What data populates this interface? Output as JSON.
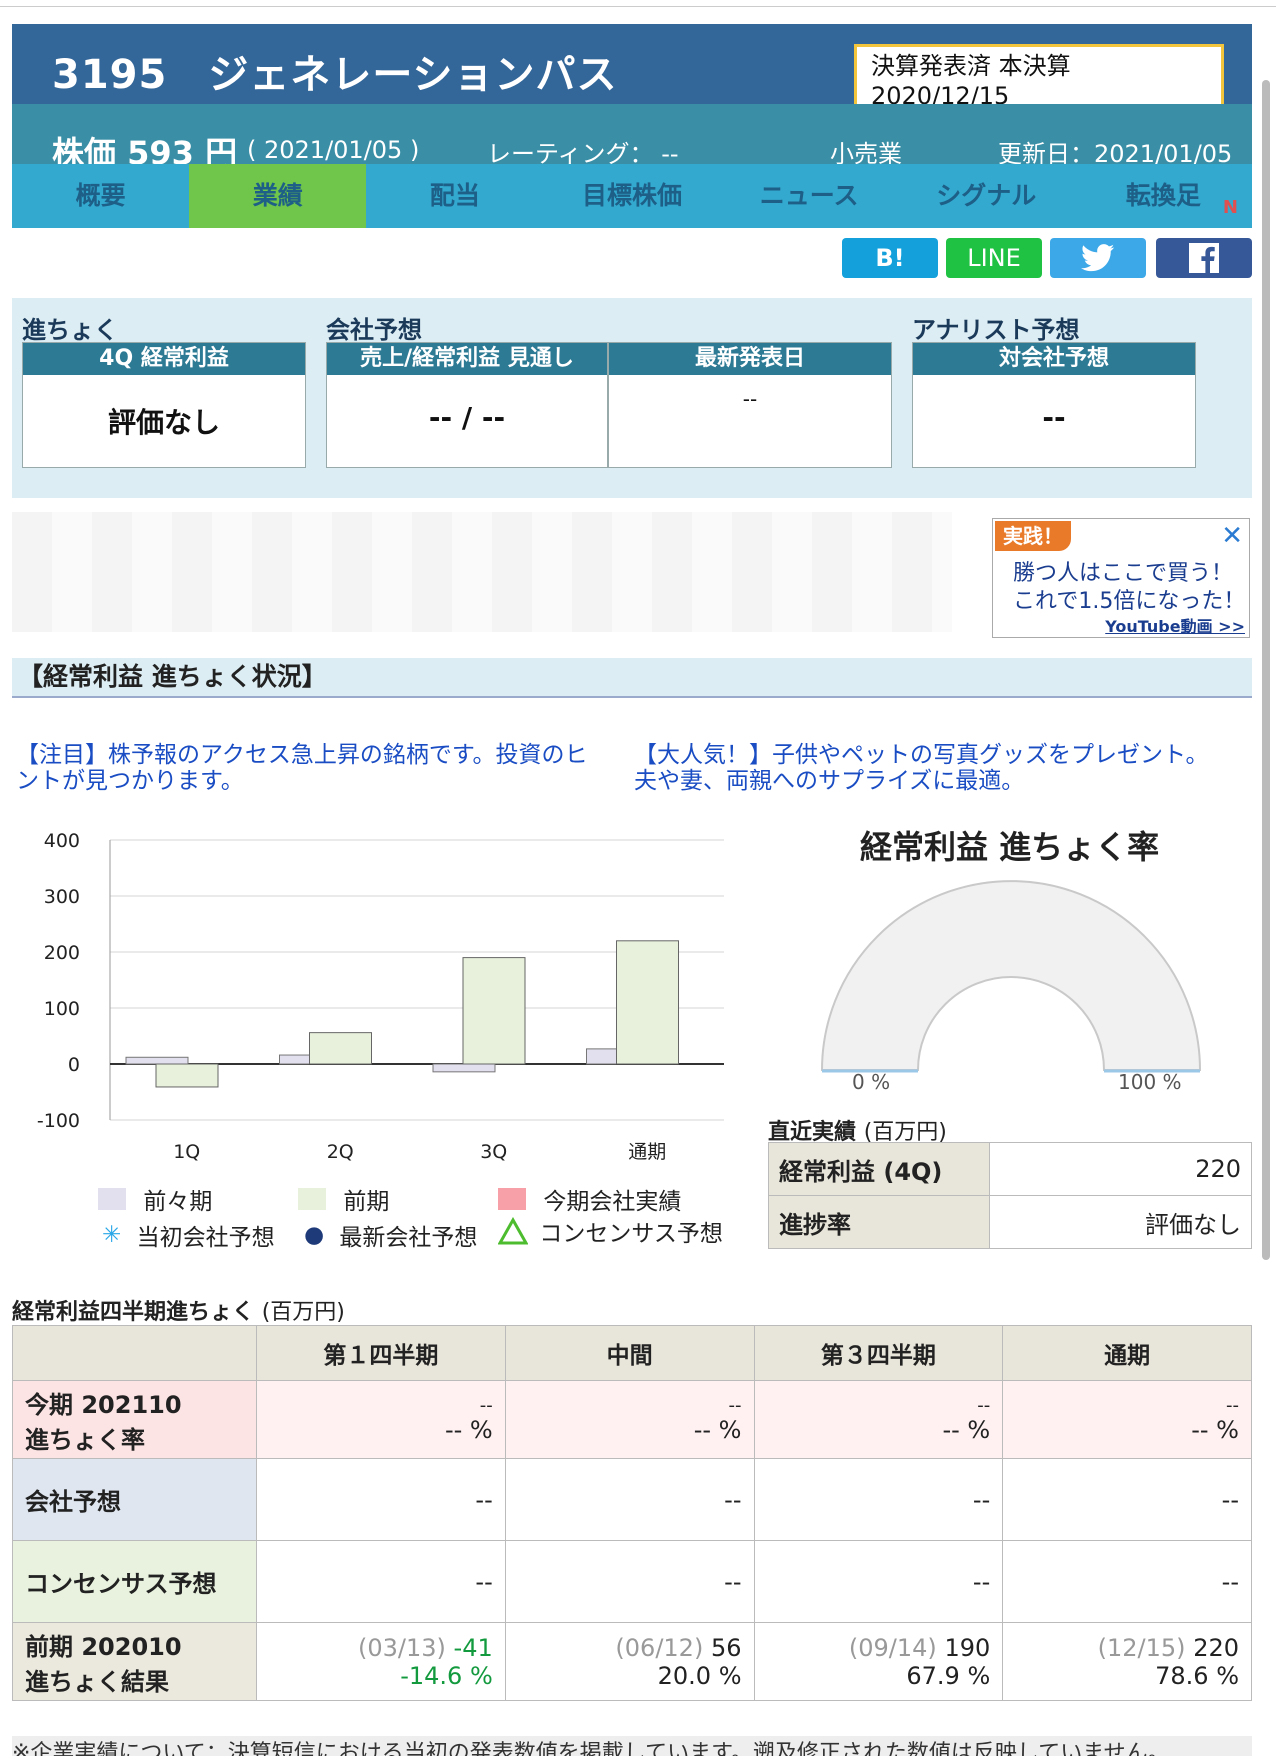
{
  "header": {
    "title": "3195　ジェネレーションパス",
    "kessan_line1": "決算発表済 本決算",
    "kessan_line2": "2020/12/15"
  },
  "pricebar": {
    "price": "株価 593 円",
    "date": "( 2021/01/05 )",
    "rating": "レーティング： --",
    "sector": "小売業",
    "updated": "更新日：2021/01/05"
  },
  "tabs": [
    "概要",
    "業績",
    "配当",
    "目標株価",
    "ニュース",
    "シグナル",
    "転換足"
  ],
  "tab_active_index": 1,
  "tab_sub": "N",
  "share": {
    "hatena": "B!",
    "line": "LINE"
  },
  "panel": {
    "progress_label": "進ちょく",
    "company_label": "会社予想",
    "analyst_label": "アナリスト予想",
    "box1_head": "4Q 経常利益",
    "box1_val": "評価なし",
    "box2_head": "売上/経常利益 見通し",
    "box2_val": "-- / --",
    "box3_head": "最新発表日",
    "box3_val": "--",
    "box4_head": "対会社予想",
    "box4_val": "--"
  },
  "ad": {
    "tag": "実践！",
    "close": "✕",
    "line1": "勝つ人はここで買う！",
    "line2": "これで1.5倍になった！",
    "youtube": "YouTube動画 >>"
  },
  "section_title": "【経常利益 進ちょく状況】",
  "promo": {
    "left1": "【注目】株予報のアクセス急上昇の銘柄です。投資のヒ",
    "left2": "ントが見つかります。",
    "right1": "【大人気！】子供やペットの写真グッズをプレゼント。",
    "right2": "夫や妻、両親へのサプライズに最適。"
  },
  "chart_data": {
    "type": "bar",
    "categories": [
      "1Q",
      "2Q",
      "3Q",
      "通期"
    ],
    "series": [
      {
        "name": "前々期",
        "values": [
          12,
          16,
          -14,
          27
        ],
        "color": "#e2dfee"
      },
      {
        "name": "前期",
        "values": [
          -41,
          56,
          190,
          220
        ],
        "color": "#e8f1dc"
      }
    ],
    "ylim": [
      -100,
      400
    ],
    "yticks": [
      "400",
      "300",
      "200",
      "100",
      "0",
      "-100"
    ],
    "ytick_values": [
      400,
      300,
      200,
      100,
      0,
      -100
    ]
  },
  "legend": {
    "zenzenki": "前々期",
    "zenki": "前期",
    "konki_jisseki": "今期会社実績",
    "tosho": "当初会社予想",
    "saishin": "最新会社予想",
    "consensus": "コンセンサス予想"
  },
  "gauge": {
    "title": "経常利益 進ちょく率",
    "min_label": "0 %",
    "max_label": "100 %",
    "value": 0
  },
  "recent": {
    "title": "直近実績",
    "unit": "(百万円)",
    "row1_key": "経常利益 (4Q)",
    "row1_val": "220",
    "row2_key": "進捗率",
    "row2_val": "評価なし"
  },
  "quarter": {
    "title": "経常利益四半期進ちょく",
    "unit": "(百万円)",
    "headers": [
      "",
      "第１四半期",
      "中間",
      "第３四半期",
      "通期"
    ],
    "row1_label1": "今期 202110",
    "row1_label2": "進ちょく率",
    "row1_top": [
      "--",
      "--",
      "--",
      "--"
    ],
    "row1_bottom": [
      "-- %",
      "-- %",
      "-- %",
      "-- %"
    ],
    "row2_label": "会社予想",
    "row2": [
      "--",
      "--",
      "--",
      "--"
    ],
    "row3_label": "コンセンサス予想",
    "row3": [
      "--",
      "--",
      "--",
      "--"
    ],
    "row4_label1": "前期 202010",
    "row4_label2": "進ちょく結果",
    "row4_dates": [
      "(03/13)",
      "(06/12)",
      "(09/14)",
      "(12/15)"
    ],
    "row4_values": [
      "-41",
      "56",
      "190",
      "220"
    ],
    "row4_pct": [
      "-14.6 %",
      "20.0 %",
      "67.9 %",
      "78.6 %"
    ]
  },
  "footnote": "※企業実績について：決算短信における当初の発表数値を掲載しています。遡及修正された数値は反映していません。"
}
